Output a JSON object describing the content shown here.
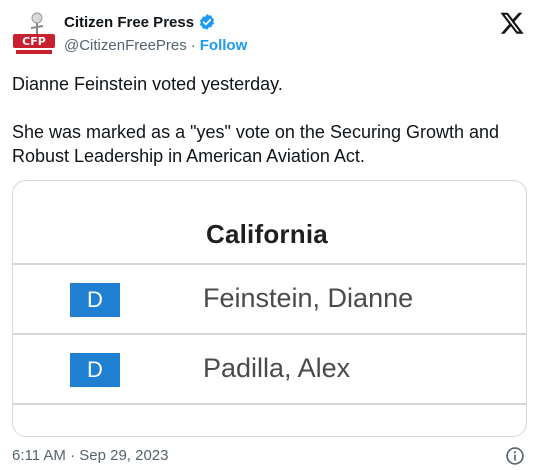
{
  "author": {
    "name": "Citizen Free Press",
    "handle": "@CitizenFreePres",
    "separator": "·",
    "follow_label": "Follow",
    "verified_color": "#1d9bf0"
  },
  "tweet": {
    "paragraphs": [
      "Dianne Feinstein voted yesterday.",
      "She was marked as a \"yes\" vote on the Securing Growth and Robust Leadership in American Aviation Act."
    ]
  },
  "media": {
    "state_title": "California",
    "rows": [
      {
        "party": "D",
        "name": "Feinstein, Dianne"
      },
      {
        "party": "D",
        "name": "Padilla, Alex"
      }
    ],
    "party_color": "#1f7fd1"
  },
  "footer": {
    "timestamp": "6:11 AM · Sep 29, 2023"
  },
  "icons": {
    "brand": "x-logo-icon",
    "info": "info-icon",
    "verified": "verified-badge-icon",
    "avatar": "citizen-free-press-logo"
  }
}
